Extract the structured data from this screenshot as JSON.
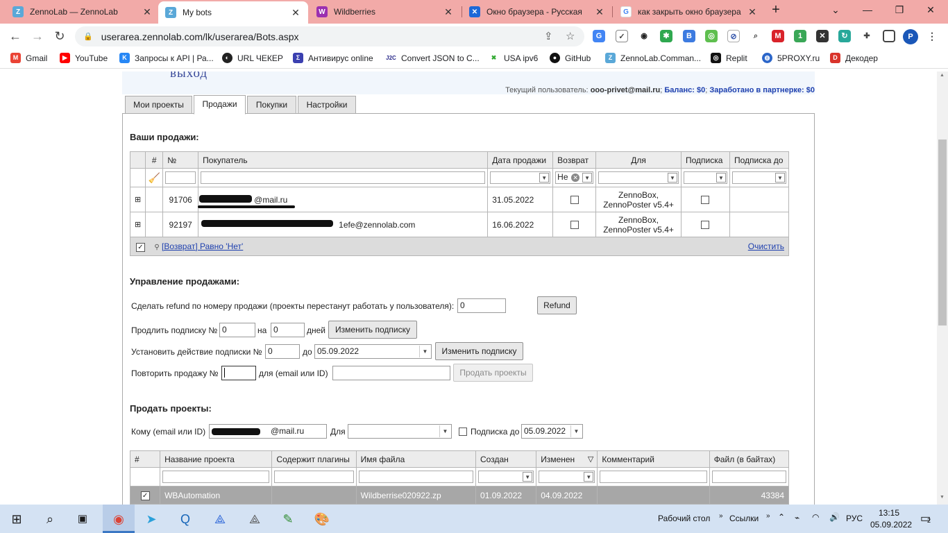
{
  "browser": {
    "tabs": [
      {
        "title": "ZennoLab — ZennoLab",
        "icon": "zennolab-icon"
      },
      {
        "title": "My bots",
        "icon": "zennolab-icon"
      },
      {
        "title": "Wildberries",
        "icon": "wildberries-icon"
      },
      {
        "title": "Окно браузера - Русская",
        "icon": "confluence-icon"
      },
      {
        "title": "как закрыть окно браузера",
        "icon": "google-icon"
      }
    ],
    "url": "userarea.zennolab.com/lk/userarea/Bots.aspx",
    "profile_letter": "P",
    "bookmarks": [
      {
        "label": "Gmail"
      },
      {
        "label": "YouTube"
      },
      {
        "label": "Запросы к API | Ра..."
      },
      {
        "label": "URL ЧЕКЕР"
      },
      {
        "label": "Антивирус online"
      },
      {
        "label": "Convert JSON to C..."
      },
      {
        "label": "USA ipv6"
      },
      {
        "label": "GitHub"
      },
      {
        "label": "ZennoLab.Comman..."
      },
      {
        "label": "Replit"
      },
      {
        "label": "5PROXY.ru"
      },
      {
        "label": "Декодер"
      }
    ]
  },
  "header": {
    "logout": "выход",
    "user_label": "Текущий пользователь:",
    "user_email": "ooo-privet@mail.ru",
    "balance": "Баланс: $0",
    "earned": "Заработано в партнерке: $0"
  },
  "page_tabs": [
    "Мои проекты",
    "Продажи",
    "Покупки",
    "Настройки"
  ],
  "sales": {
    "heading": "Ваши продажи:",
    "columns": [
      "#",
      "№",
      "Покупатель",
      "Дата продажи",
      "Возврат",
      "Для",
      "Подписка",
      "Подписка до"
    ],
    "refund_filter": "Не",
    "rows": [
      {
        "expand": "⊞",
        "num": "91706",
        "buyer": "@mail.ru",
        "date": "31.05.2022",
        "for_line1": "ZennoBox,",
        "for_line2": "ZennoPoster v5.4+"
      },
      {
        "expand": "⊞",
        "num": "92197",
        "buyer": "1efe@zennolab.com",
        "date": "16.06.2022",
        "for_line1": "ZennoBox,",
        "for_line2": "ZennoPoster v5.4+"
      }
    ],
    "filter_text": "[Возврат] Равно 'Нет'",
    "clear": "Очистить"
  },
  "manage": {
    "heading": "Управление продажами:",
    "refund_label": "Сделать refund по номеру продажи (проекты перестанут работать у пользователя):",
    "refund_value": "0",
    "refund_button": "Refund",
    "extend_label": "Продлить подписку №",
    "extend_num": "0",
    "extend_on": "на",
    "extend_days": "0",
    "days_label": "дней",
    "change_sub_button": "Изменить подписку",
    "set_label": "Установить действие подписки №",
    "set_num": "0",
    "to_label": "до",
    "set_date": "05.09.2022",
    "change_sub_button2": "Изменить подписку",
    "repeat_label": "Повторить продажу №",
    "for_label": "для (email или ID)",
    "sell_button": "Продать проекты"
  },
  "sell": {
    "heading": "Продать проекты:",
    "to_label": "Кому (email или ID)",
    "to_value": "@mail.ru",
    "for_label": "Для",
    "sub_label": "Подписка до",
    "sub_date": "05.09.2022",
    "columns": [
      "#",
      "Название проекта",
      "Содержит плагины",
      "Имя файла",
      "Создан",
      "Изменен",
      "Комментарий",
      "Файл (в байтах)"
    ],
    "sort_mark": "▽",
    "rows": [
      {
        "name": "WBAutomation",
        "plugins": "",
        "file": "Wildberrise020922.zp",
        "created": "01.09.2022",
        "modified": "04.09.2022",
        "comment": "",
        "size": "43384"
      }
    ]
  },
  "taskbar": {
    "desktop": "Рабочий стол",
    "links": "Ссылки",
    "lang": "РУС",
    "time": "13:15",
    "date": "05.09.2022",
    "notif_count": "2"
  },
  "colors": {
    "tabstrip": "#f2aaa8",
    "link_blue": "#1d3fae",
    "selected_row": "#a7a7a7"
  }
}
